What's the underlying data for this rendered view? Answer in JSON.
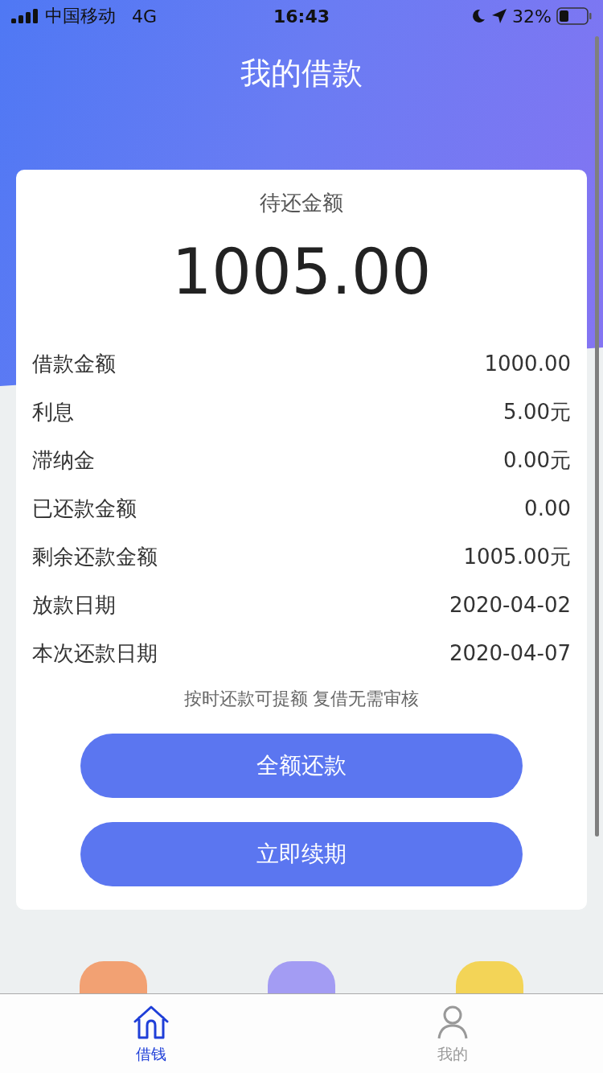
{
  "status_bar": {
    "carrier": "中国移动",
    "network": "4G",
    "time": "16:43",
    "battery": "32%"
  },
  "title": "我的借款",
  "summary": {
    "label": "待还金额",
    "amount": "1005.00"
  },
  "details": [
    {
      "label": "借款金额",
      "value": "1000.00"
    },
    {
      "label": "利息",
      "value": "5.00元"
    },
    {
      "label": "滞纳金",
      "value": "0.00元"
    },
    {
      "label": "已还款金额",
      "value": "0.00"
    },
    {
      "label": "剩余还款金额",
      "value": "1005.00元"
    },
    {
      "label": "放款日期",
      "value": "2020-04-02"
    },
    {
      "label": "本次还款日期",
      "value": "2020-04-07"
    }
  ],
  "notice": "按时还款可提额 复借无需审核",
  "buttons": [
    "全额还款",
    "立即续期"
  ],
  "tabs": [
    {
      "label": "借钱",
      "kind": "home",
      "selected": true
    },
    {
      "label": "我的",
      "kind": "person",
      "selected": false
    }
  ]
}
